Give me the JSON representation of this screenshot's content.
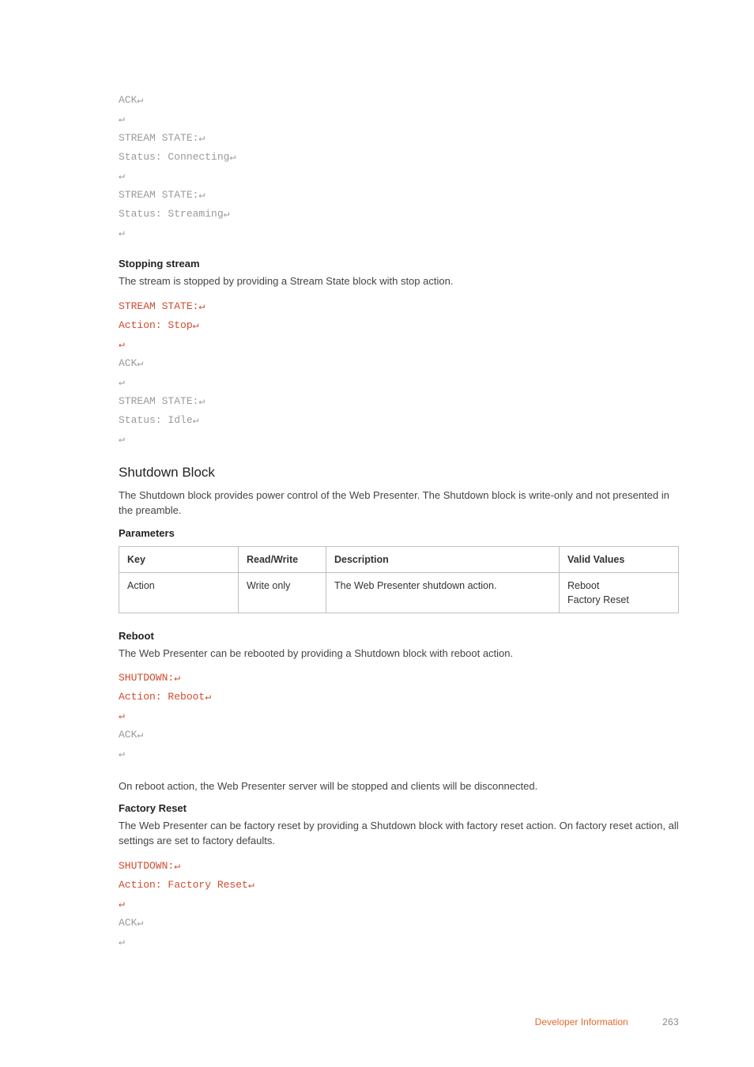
{
  "glyph": {
    "ret": "↵"
  },
  "code_top": {
    "l1": "ACK",
    "l2": "",
    "l3": "STREAM STATE:",
    "l4": "Status: Connecting",
    "l5": "",
    "l6": "STREAM STATE:",
    "l7": "Status: Streaming",
    "l8": ""
  },
  "stopping": {
    "heading": "Stopping stream",
    "para": "The stream is stopped by providing a Stream State block with stop action.",
    "code": {
      "l1": "STREAM STATE:",
      "l2": "Action: Stop",
      "l3": "",
      "l4": "ACK",
      "l5": "",
      "l6": "STREAM STATE:",
      "l7": "Status: Idle",
      "l8": ""
    }
  },
  "shutdown": {
    "heading": "Shutdown Block",
    "para": "The Shutdown block provides power control of the Web Presenter. The Shutdown block is write-only and not presented in the preamble.",
    "params_heading": "Parameters",
    "table": {
      "head": {
        "key": "Key",
        "rw": "Read/Write",
        "desc": "Description",
        "valid": "Valid Values"
      },
      "row1": {
        "key": "Action",
        "rw": "Write only",
        "desc": "The Web Presenter shutdown action.",
        "valid_l1": "Reboot",
        "valid_l2": "Factory Reset"
      }
    }
  },
  "reboot": {
    "heading": "Reboot",
    "para": "The Web Presenter can be rebooted by providing a Shutdown block with reboot action.",
    "code": {
      "l1": "SHUTDOWN:",
      "l2": "Action: Reboot",
      "l3": "",
      "l4": "ACK",
      "l5": ""
    },
    "after": "On reboot action, the Web Presenter server will be stopped and clients will be disconnected."
  },
  "factory": {
    "heading": "Factory Reset",
    "para": "The Web Presenter can be factory reset by providing a Shutdown block with factory reset action. On factory reset action, all settings are set to factory defaults.",
    "code": {
      "l1": "SHUTDOWN:",
      "l2": "Action: Factory Reset",
      "l3": "",
      "l4": "ACK",
      "l5": ""
    }
  },
  "footer": {
    "section": "Developer Information",
    "page": "263"
  }
}
